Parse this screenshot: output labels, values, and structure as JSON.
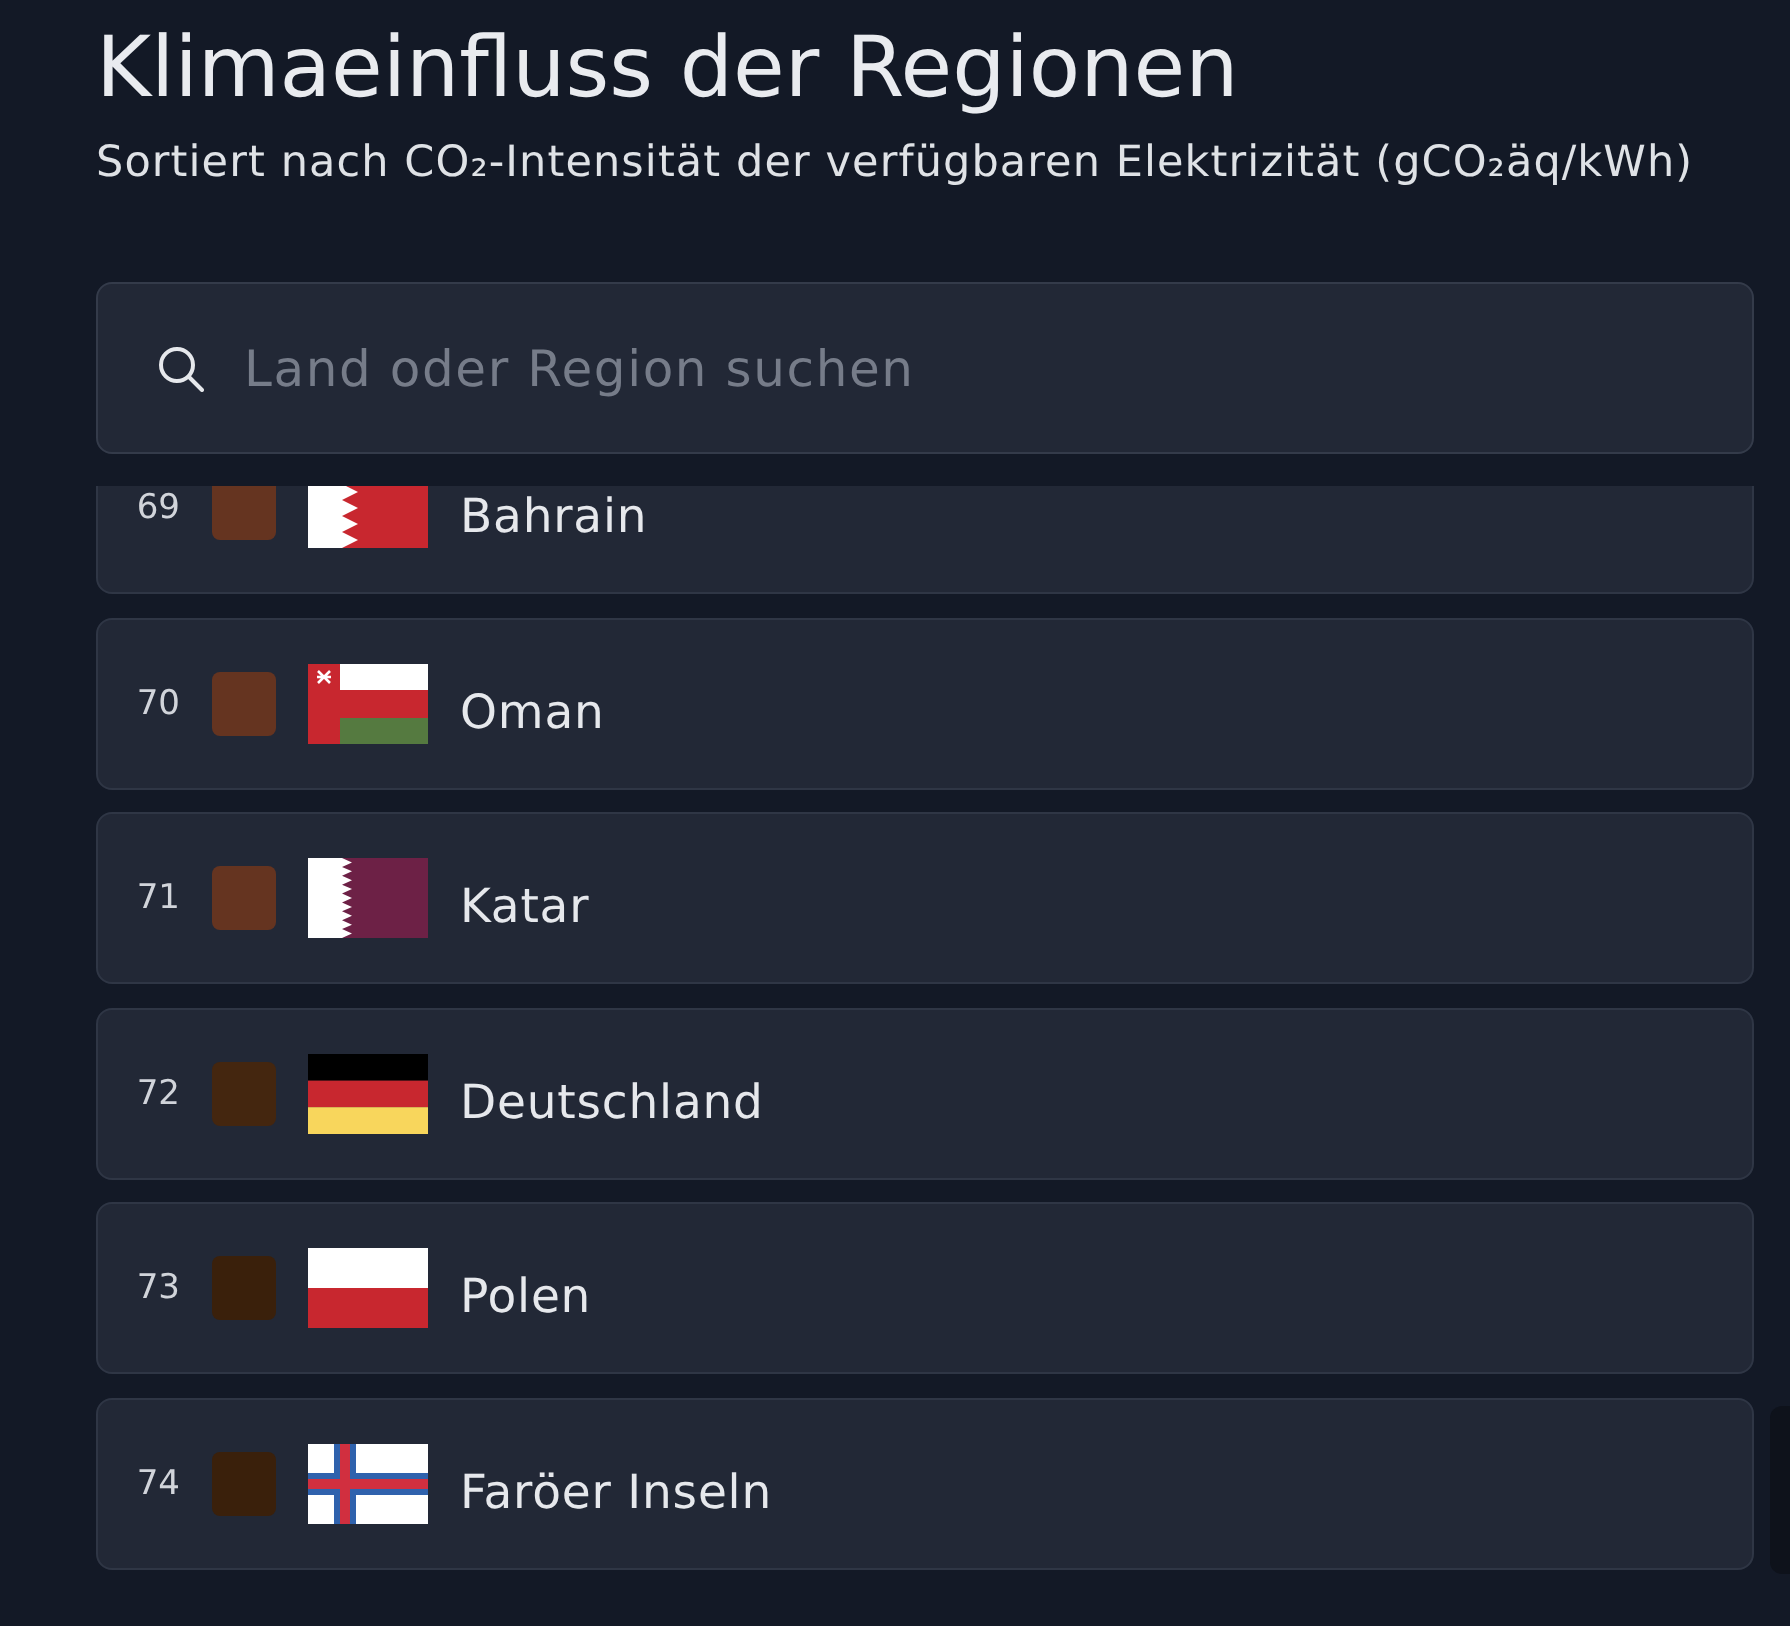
{
  "header": {
    "title": "Klimaeinfluss der Regionen",
    "subtitle": "Sortiert nach CO₂-Intensität der verfügbaren Elektrizität (gCO₂äq/kWh)"
  },
  "search": {
    "placeholder": "Land oder Region suchen"
  },
  "regions": [
    {
      "rank": "69",
      "color": "#653420",
      "kind": "bahrain",
      "name": "Bahrain"
    },
    {
      "rank": "70",
      "color": "#653420",
      "kind": "oman",
      "name": "Oman"
    },
    {
      "rank": "71",
      "color": "#653420",
      "kind": "qatar",
      "name": "Katar"
    },
    {
      "rank": "72",
      "color": "#44260f",
      "kind": "germany",
      "name": "Deutschland"
    },
    {
      "rank": "73",
      "color": "#3a200b",
      "kind": "poland",
      "name": "Polen"
    },
    {
      "rank": "74",
      "color": "#3a200b",
      "kind": "faroe",
      "name": "Faröer Inseln"
    }
  ]
}
